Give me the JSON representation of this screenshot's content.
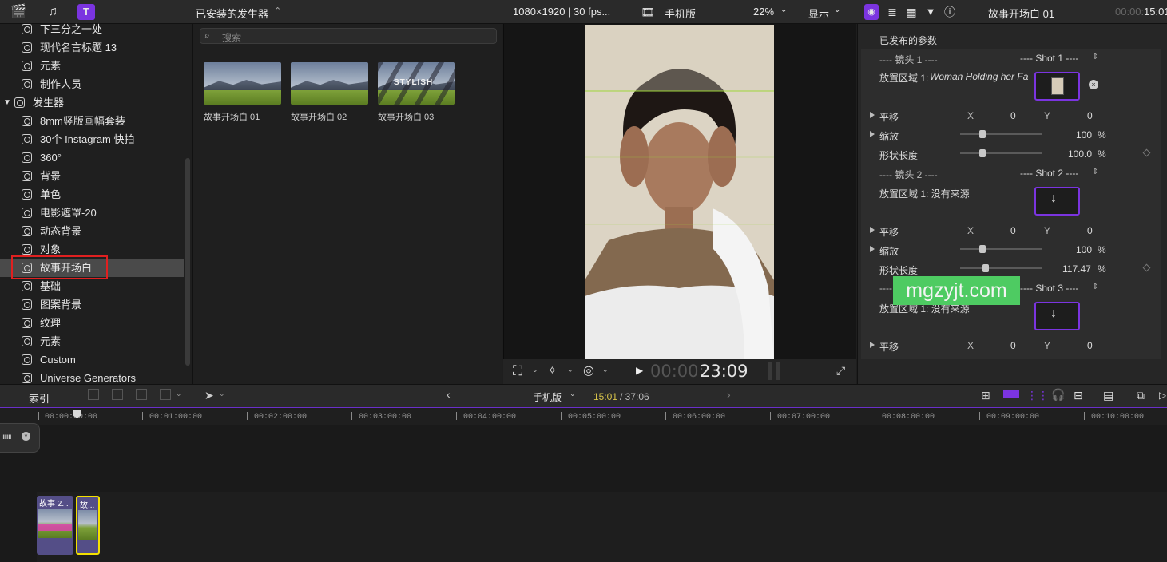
{
  "topbar": {
    "browser_title": "已安装的发生器",
    "viewer_format": "1080×1920 | 30 fps...",
    "viewer_project": "手机版",
    "zoom": "22%",
    "display_menu": "显示",
    "inspector_title": "故事开场白 01",
    "inspector_time_dim": "00:00:",
    "inspector_time": "15:01"
  },
  "sidebar": {
    "items": [
      {
        "label": "下三分之一处"
      },
      {
        "label": "现代名言标题 13"
      },
      {
        "label": "元素"
      },
      {
        "label": "制作人员"
      },
      {
        "label": "发生器"
      },
      {
        "label": "8mm竖版画幅套装"
      },
      {
        "label": "30个 Instagram 快拍"
      },
      {
        "label": "360°"
      },
      {
        "label": "背景"
      },
      {
        "label": "单色"
      },
      {
        "label": "电影遮罩-20"
      },
      {
        "label": "动态背景"
      },
      {
        "label": "对象"
      },
      {
        "label": "故事开场白"
      },
      {
        "label": "基础"
      },
      {
        "label": "图案背景"
      },
      {
        "label": "纹理"
      },
      {
        "label": "元素"
      },
      {
        "label": "Custom"
      },
      {
        "label": "Universe Generators"
      }
    ]
  },
  "browser": {
    "search_placeholder": "搜索",
    "thumbs": [
      {
        "label": "故事开场白 01"
      },
      {
        "label": "故事开场白 02"
      },
      {
        "label": "故事开场白 03",
        "overlay": "STYLISH"
      }
    ]
  },
  "viewer": {
    "timecode_dim": "00:00:",
    "timecode": "23:09"
  },
  "inspector": {
    "section_title": "已发布的参数",
    "shot1_label": "---- 镜头 1 ----",
    "shot1_value": "---- Shot 1 ----",
    "drop1_label": "放置区域 1:",
    "drop1_value": "Woman Holding her Fa",
    "pan_label": "平移",
    "x_label": "X",
    "y_label": "Y",
    "zero": "0",
    "scale_label": "缩放",
    "scale1": "100",
    "percent": "%",
    "shape_label": "形状长度",
    "shape1": "100.0",
    "shot2_label": "---- 镜头 2 ----",
    "shot2_value": "---- Shot 2 ----",
    "drop_none": "放置区域 1: 没有来源",
    "scale2": "100",
    "shape2": "117.47",
    "shot3_label": "----",
    "shot3_value": "---- Shot 3 ----"
  },
  "timeline": {
    "index_label": "索引",
    "project": "手机版",
    "time_current": "15:01",
    "time_total": "/ 37:06",
    "ruler": [
      "00:00:00:00",
      "00:01:00:00",
      "00:02:00:00",
      "00:03:00:00",
      "00:04:00:00",
      "00:05:00:00",
      "00:06:00:00",
      "00:07:00:00",
      "00:08:00:00",
      "00:09:00:00",
      "00:10:00:00"
    ],
    "clips": [
      {
        "title": "故事 2..."
      },
      {
        "title": "故..."
      }
    ]
  },
  "watermark": "mgzyjt.com",
  "colors": {
    "accent": "#7b34e0",
    "selection": "#e02020",
    "clip": "#544e87",
    "watermark": "#4ecb62"
  }
}
